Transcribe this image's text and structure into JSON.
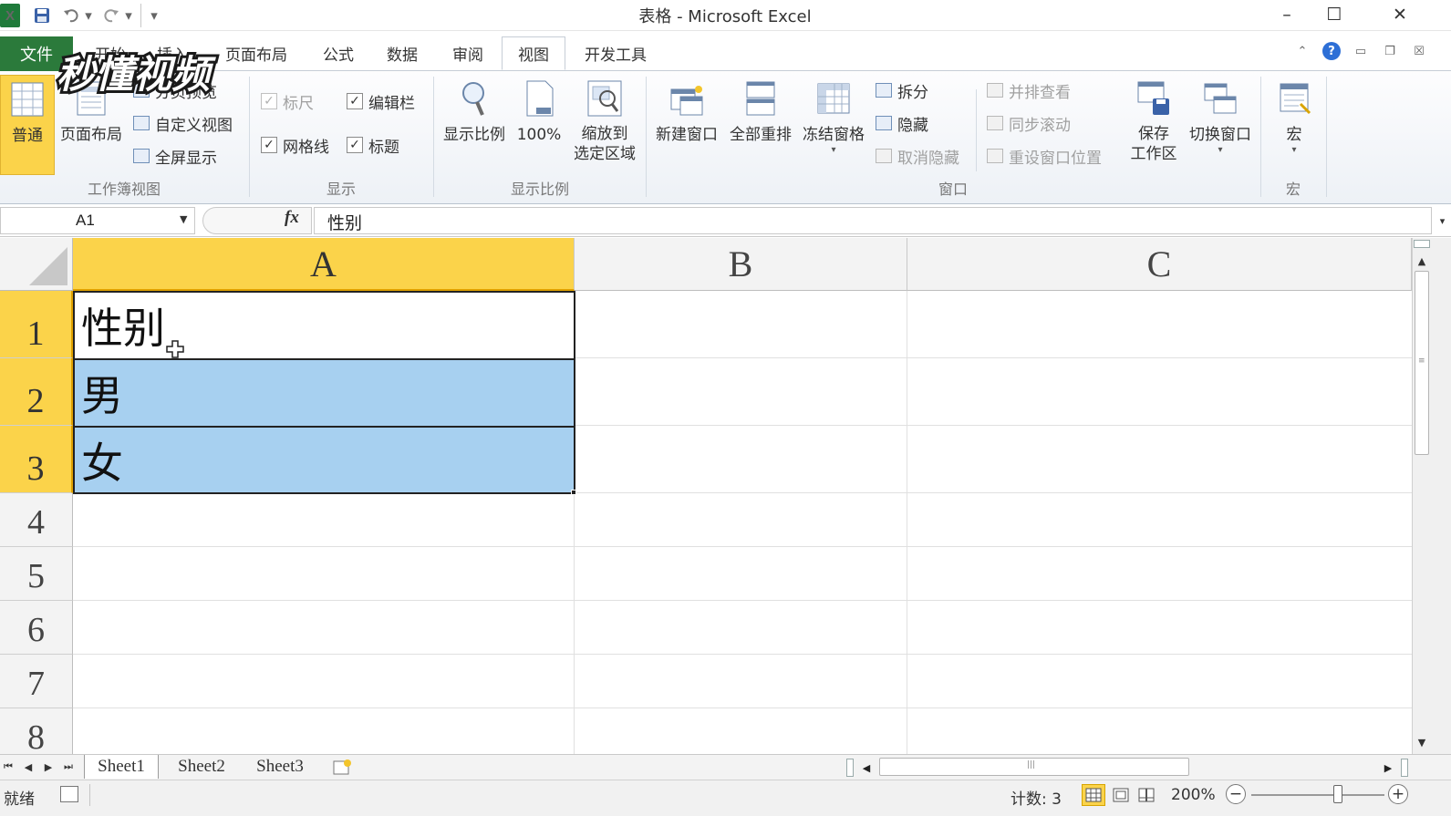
{
  "window": {
    "title": "表格 - Microsoft Excel",
    "app_icon_label": "X",
    "minimize": "–",
    "maximize": "☐",
    "close": "✕"
  },
  "quick_access": {
    "icons": [
      "save-icon",
      "undo-icon",
      "redo-icon",
      "customize-quick-access-icon"
    ]
  },
  "watermark": {
    "text": "秒懂视频"
  },
  "tabs": [
    {
      "label": "文件"
    },
    {
      "label": "开始"
    },
    {
      "label": "插入"
    },
    {
      "label": "页面布局"
    },
    {
      "label": "公式"
    },
    {
      "label": "数据"
    },
    {
      "label": "审阅"
    },
    {
      "label": "视图",
      "active": true
    },
    {
      "label": "开发工具"
    }
  ],
  "ribbon": {
    "workbook_views": {
      "label": "工作簿视图",
      "normal": "普通",
      "page_layout": "页面布局",
      "page_break_preview": "分页预览",
      "custom_views": "自定义视图",
      "full_screen": "全屏显示"
    },
    "show": {
      "label": "显示",
      "ruler": "标尺",
      "ruler_checked": true,
      "formula_bar": "编辑栏",
      "formula_bar_checked": true,
      "gridlines": "网格线",
      "gridlines_checked": true,
      "headings": "标题",
      "headings_checked": true
    },
    "zoom": {
      "label": "显示比例",
      "zoom": "显示比例",
      "zoom_100": "100%",
      "zoom_to_selection_line1": "缩放到",
      "zoom_to_selection_line2": "选定区域"
    },
    "window": {
      "label": "窗口",
      "new_window": "新建窗口",
      "arrange_all": "全部重排",
      "freeze_panes": "冻结窗格",
      "split": "拆分",
      "hide": "隐藏",
      "unhide": "取消隐藏",
      "view_side_by_side": "并排查看",
      "synchronous_scrolling": "同步滚动",
      "reset_window_position": "重设窗口位置",
      "save_workspace_line1": "保存",
      "save_workspace_line2": "工作区",
      "switch_windows": "切换窗口"
    },
    "macros": {
      "label": "宏",
      "macros": "宏"
    }
  },
  "formula_bar": {
    "name_box": "A1",
    "fx": "fx",
    "value": "性别"
  },
  "grid": {
    "columns": [
      "A",
      "B",
      "C"
    ],
    "rows": [
      "1",
      "2",
      "3",
      "4",
      "5",
      "6",
      "7",
      "8"
    ],
    "cells": {
      "A1": "性别",
      "A2": "男",
      "A3": "女"
    }
  },
  "sheets": [
    "Sheet1",
    "Sheet2",
    "Sheet3"
  ],
  "status": {
    "ready": "就绪",
    "count": "计数: 3",
    "zoom": "200%",
    "zoom_percent": 200
  },
  "colors": {
    "file_tab": "#2b7a3b",
    "selected_header": "#fbd34a",
    "selection_fill": "#a7d0f0"
  }
}
